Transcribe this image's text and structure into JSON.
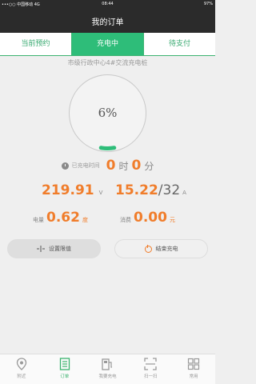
{
  "status_bar": {
    "carrier": "•••○○ 中国移动 4G",
    "time": "08:44",
    "battery": "97%"
  },
  "nav": {
    "title": "我的订单"
  },
  "tabs": [
    {
      "label": "当前预约",
      "active": false
    },
    {
      "label": "充电中",
      "active": true
    },
    {
      "label": "待支付",
      "active": false
    }
  ],
  "station": "市级行政中心4#交流充电桩",
  "progress": {
    "label": "6%",
    "value": 0.06
  },
  "duration": {
    "label": "已充电时间",
    "hours": "0",
    "hours_unit": "时",
    "minutes": "0",
    "minutes_unit": "分"
  },
  "voltage": {
    "value": "219.91",
    "unit": "V"
  },
  "current": {
    "value": "15.22",
    "max": "/32",
    "unit": "A"
  },
  "energy": {
    "label": "电量",
    "value": "0.62",
    "unit": "度"
  },
  "cost": {
    "label": "消费",
    "value": "0.00",
    "unit": "元"
  },
  "buttons": {
    "limit": "设置限值",
    "stop": "结束充电"
  },
  "tabbar": [
    {
      "label": "附近",
      "icon": "location-pin-icon",
      "active": false
    },
    {
      "label": "订单",
      "icon": "order-list-icon",
      "active": true
    },
    {
      "label": "我要充电",
      "icon": "charging-station-icon",
      "active": false
    },
    {
      "label": "扫一扫",
      "icon": "scan-icon",
      "active": false
    },
    {
      "label": "常用",
      "icon": "grid-icon",
      "active": false
    }
  ],
  "colors": {
    "accent_green": "#2ebd79",
    "value_orange": "#f07d2b",
    "bar_dark": "#2b2b2b"
  }
}
